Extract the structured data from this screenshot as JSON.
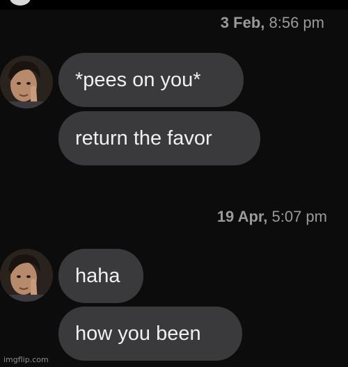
{
  "conversation": {
    "groups": [
      {
        "timestamp_date": "3 Feb,",
        "timestamp_time": "8:56 pm",
        "messages": [
          {
            "text": "*pees on you*"
          },
          {
            "text": "return the favor"
          }
        ]
      },
      {
        "timestamp_date": "19 Apr,",
        "timestamp_time": "5:07 pm",
        "messages": [
          {
            "text": "haha"
          },
          {
            "text": "how you been"
          }
        ]
      }
    ]
  },
  "watermark": "imgflip.com",
  "colors": {
    "background": "#0c0c0c",
    "bubble": "#3a3a3c",
    "timestamp": "#9a9a9a",
    "message_text": "#f0f0f0"
  }
}
